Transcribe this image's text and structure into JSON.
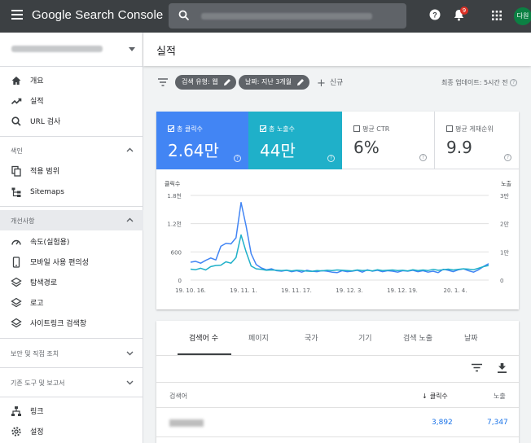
{
  "header": {
    "app_title": "Google Search Console",
    "notification_count": "9",
    "avatar_text": "다원"
  },
  "sidebar": {
    "primary": [
      {
        "label": "개요",
        "icon": "home-icon"
      },
      {
        "label": "실적",
        "icon": "trending-up-icon"
      },
      {
        "label": "URL 검사",
        "icon": "search-icon"
      }
    ],
    "index_section": "색인",
    "index_items": [
      {
        "label": "적용 범위",
        "icon": "copy-icon"
      },
      {
        "label": "Sitemaps",
        "icon": "sitemap-icon"
      }
    ],
    "enhancements_section": "개선사항",
    "enhancements_items": [
      {
        "label": "속도(실험용)",
        "icon": "speed-icon"
      },
      {
        "label": "모바일 사용 편의성",
        "icon": "mobile-icon"
      },
      {
        "label": "탐색경로",
        "icon": "layers-icon"
      },
      {
        "label": "로고",
        "icon": "layers-icon"
      },
      {
        "label": "사이트링크 검색창",
        "icon": "layers-icon"
      }
    ],
    "security_section": "보안 및 직접 조치",
    "legacy_section": "기존 도구 및 보고서",
    "bottom_items": [
      {
        "label": "링크",
        "icon": "links-icon"
      },
      {
        "label": "설정",
        "icon": "gear-icon"
      }
    ]
  },
  "page": {
    "title": "실적",
    "filters": [
      "검색 유형: 웹",
      "날짜: 지난 3개월"
    ],
    "new_label": "신규",
    "last_updated": "최종 업데이트: 5시간 전"
  },
  "metrics": [
    {
      "label": "총 클릭수",
      "value": "2.64만",
      "checked": true,
      "color": "#4285f4"
    },
    {
      "label": "총 노출수",
      "value": "44만",
      "checked": true,
      "color": "#1fb0c9"
    },
    {
      "label": "평균 CTR",
      "value": "6%",
      "checked": false
    },
    {
      "label": "평균 게재순위",
      "value": "9.9",
      "checked": false
    }
  ],
  "chart_data": {
    "type": "line",
    "left_axis_label": "클릭수",
    "right_axis_label": "노출",
    "left_ticks": [
      "1.8천",
      "1.2천",
      "600",
      "0"
    ],
    "right_ticks": [
      "3만",
      "2만",
      "1만",
      "0"
    ],
    "left_ylim": [
      0,
      1800
    ],
    "right_ylim": [
      0,
      30000
    ],
    "x_tick_labels": [
      "19. 10. 16.",
      "19. 11. 1.",
      "19. 11. 17.",
      "19. 12. 3.",
      "19. 12. 19.",
      "20. 1. 4."
    ],
    "grid": true,
    "series": [
      {
        "name": "총 클릭수",
        "axis": "left",
        "color": "#4285f4",
        "values": [
          380,
          400,
          360,
          420,
          470,
          430,
          720,
          780,
          770,
          900,
          1650,
          1150,
          560,
          330,
          260,
          220,
          240,
          200,
          190,
          210,
          180,
          200,
          170,
          210,
          190,
          180,
          200,
          190,
          170,
          160,
          200,
          180,
          190,
          210,
          170,
          220,
          190,
          210,
          180,
          200,
          190,
          170,
          200,
          190,
          210,
          180,
          200,
          170,
          190,
          160,
          230,
          210,
          180,
          220,
          240,
          200,
          170,
          220,
          290,
          350
        ]
      },
      {
        "name": "총 노출수",
        "axis": "right",
        "color": "#1fb0c9",
        "values": [
          3900,
          3700,
          4200,
          3600,
          4800,
          5200,
          5300,
          6500,
          6000,
          8000,
          16000,
          10000,
          5000,
          4000,
          3800,
          3500,
          3600,
          3500,
          3400,
          3500,
          3300,
          3500,
          3400,
          3200,
          3100,
          3400,
          3300,
          3500,
          3400,
          3600,
          3500,
          3400,
          3300,
          3600,
          3400,
          3500,
          3300,
          3700,
          3400,
          3500,
          3600,
          3400,
          3500,
          3300,
          3700,
          3400,
          3600,
          3400,
          3800,
          3500,
          3700,
          3900,
          3600,
          3800,
          4000,
          3900,
          3700,
          4200,
          4800,
          5200
        ]
      }
    ]
  },
  "table": {
    "tabs": [
      "검색어 수",
      "페이지",
      "국가",
      "기기",
      "검색 노출",
      "날짜"
    ],
    "columns": [
      "검색어",
      "클릭수",
      "노출"
    ],
    "rows": [
      {
        "clicks": "3,892",
        "impressions": "7,347"
      }
    ]
  }
}
